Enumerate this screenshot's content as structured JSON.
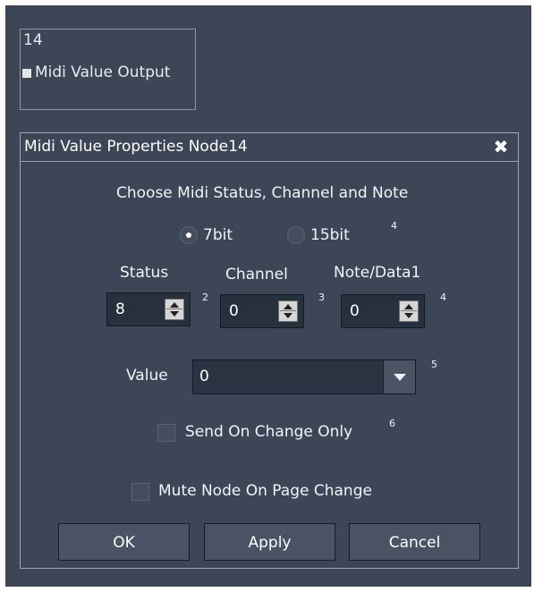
{
  "node": {
    "number": "14",
    "label": "Midi Value Output"
  },
  "dialog": {
    "title": "Midi Value Properties Node14",
    "close_glyph": "✖",
    "heading": "Choose Midi Status, Channel and Note",
    "resolution": {
      "options": [
        "7bit",
        "15bit"
      ],
      "selected": "7bit",
      "hint": "4"
    },
    "status": {
      "label": "Status",
      "value": "8",
      "hint": "2"
    },
    "channel": {
      "label": "Channel",
      "value": "0",
      "hint": "3"
    },
    "note": {
      "label": "Note/Data1",
      "value": "0",
      "hint": "4"
    },
    "value_field": {
      "label": "Value",
      "value": "0",
      "hint": "5"
    },
    "send_on_change": {
      "label": "Send On Change Only",
      "checked": false,
      "hint": "6"
    },
    "mute_node": {
      "label": "Mute Node On Page Change",
      "checked": false
    },
    "buttons": {
      "ok": "OK",
      "apply": "Apply",
      "cancel": "Cancel"
    }
  },
  "colors": {
    "background": "#3c4656",
    "field": "#27303d",
    "button": "#4a5364",
    "text": "#ffffff"
  },
  "icons": [
    "close-icon",
    "spin-arrows-icon",
    "dropdown-arrow-icon"
  ]
}
